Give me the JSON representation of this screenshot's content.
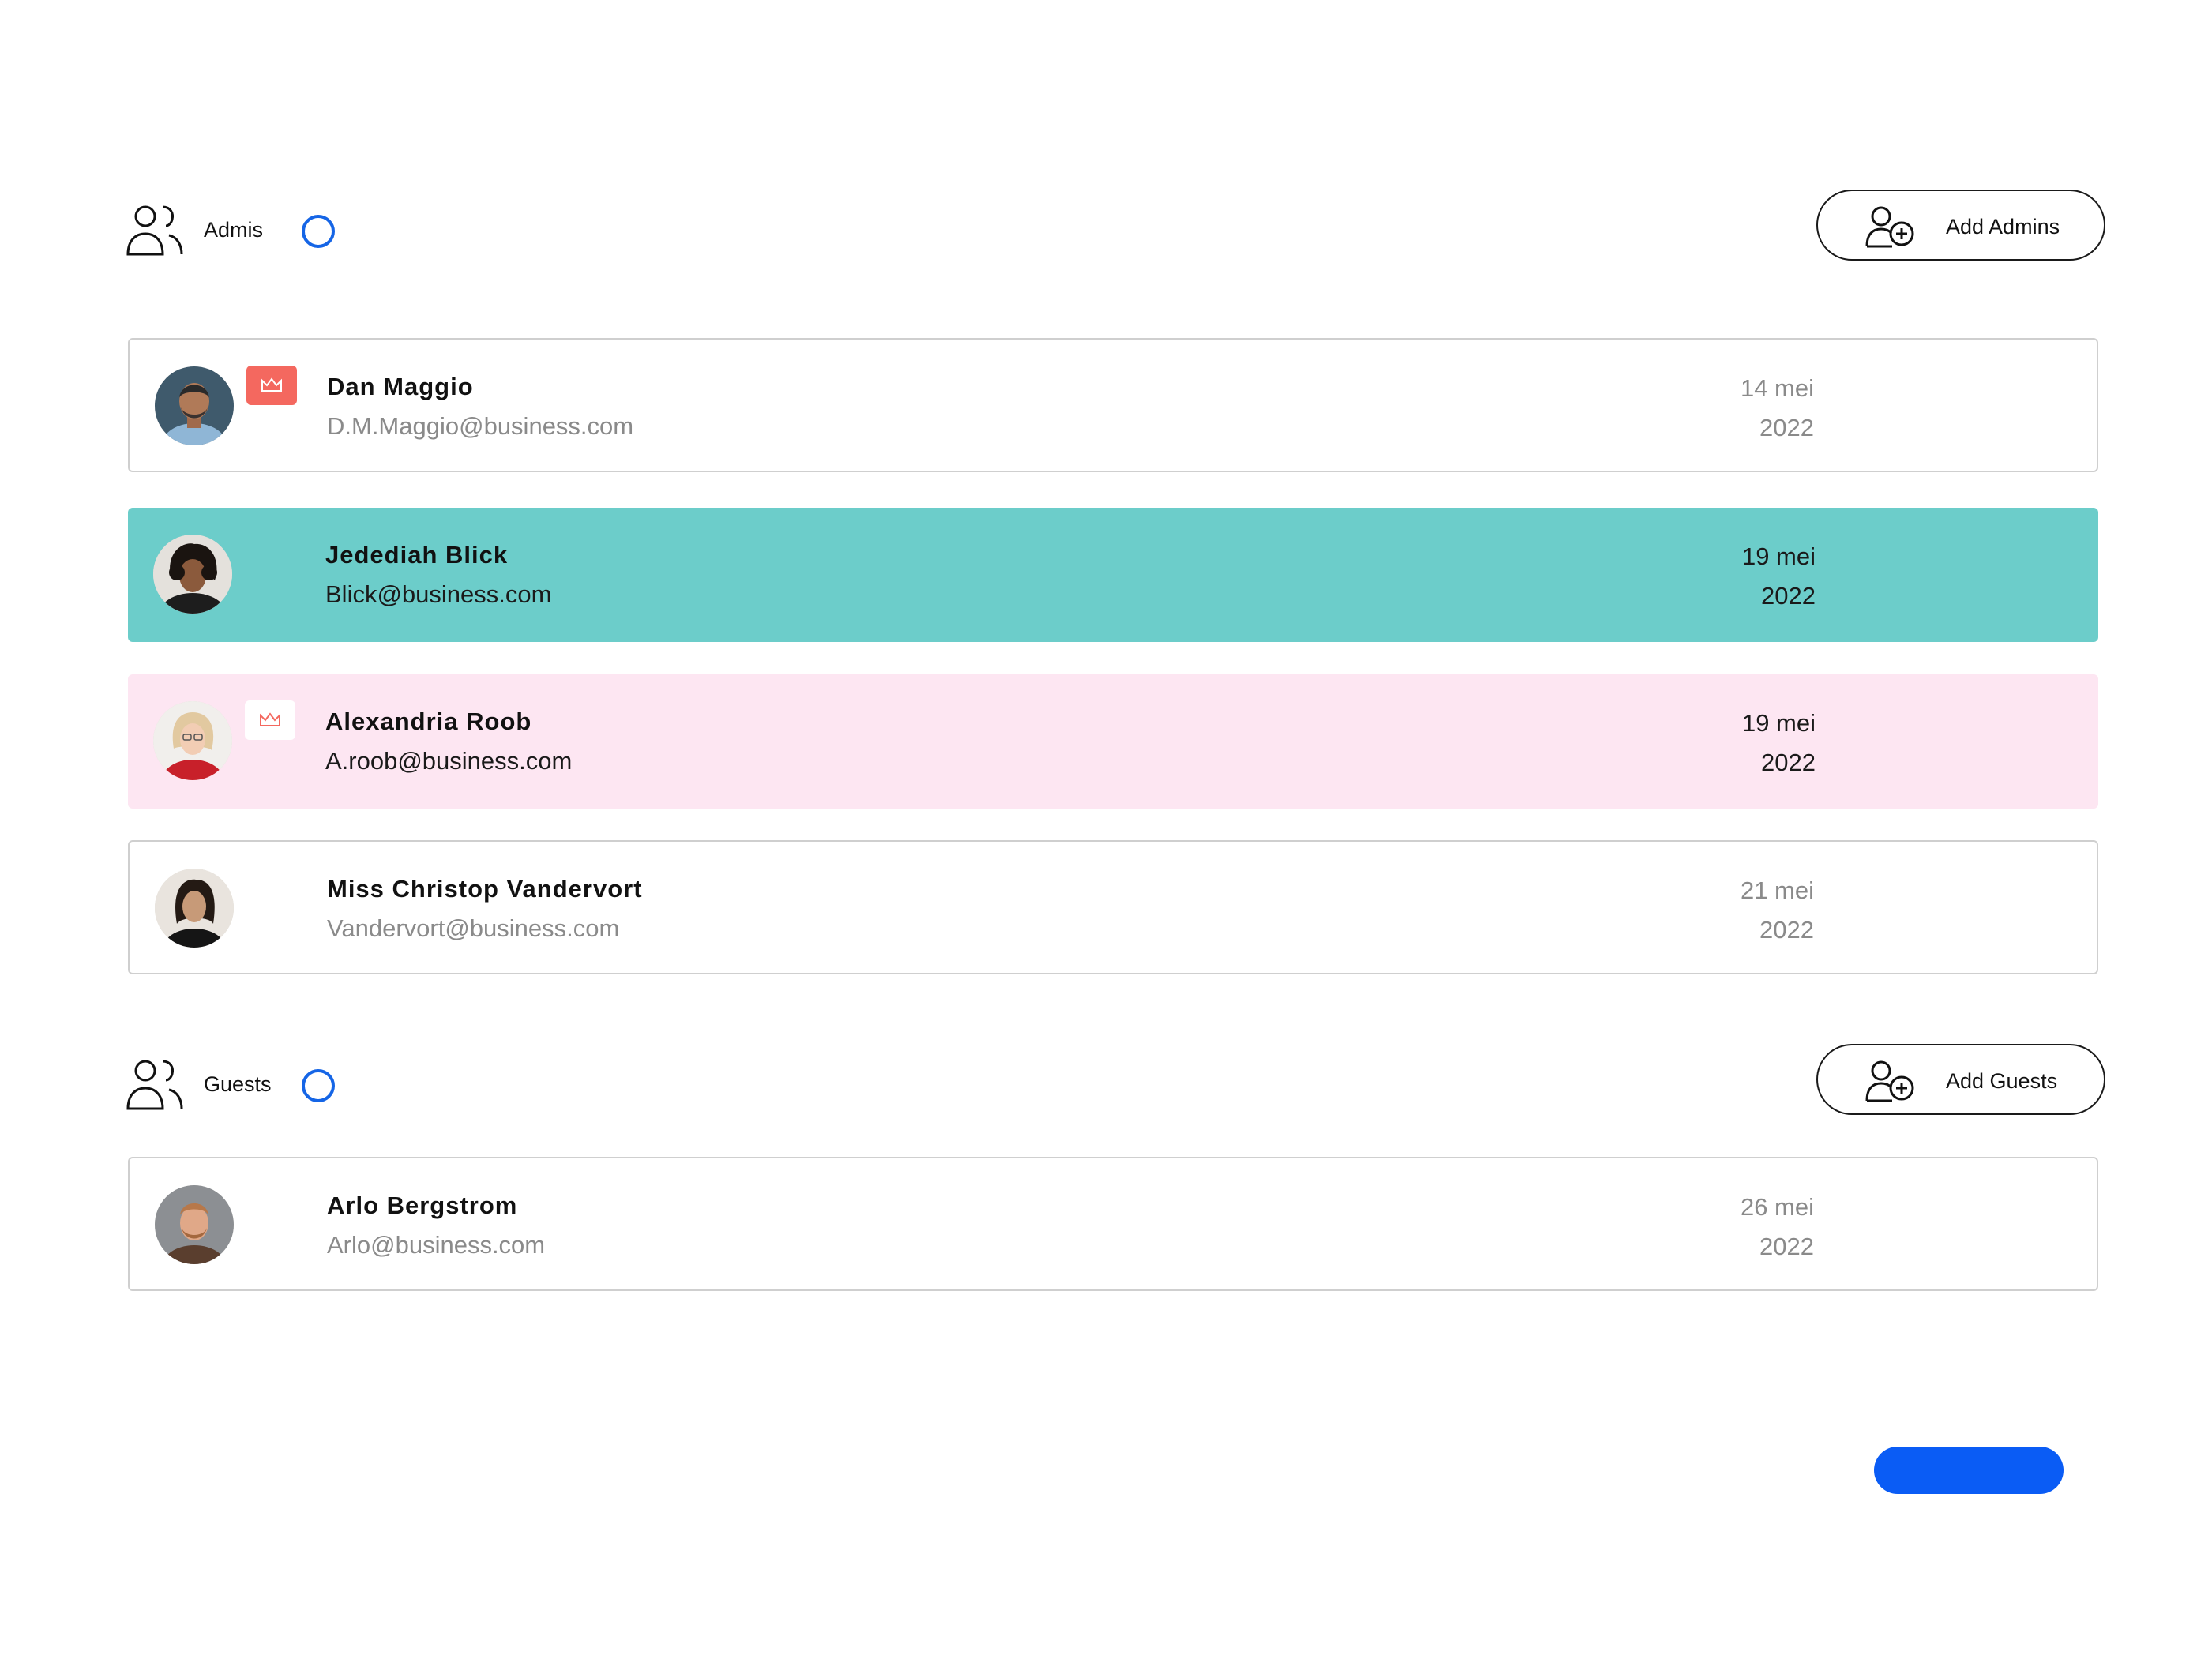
{
  "admins_section": {
    "label": "Admis",
    "icon": "users-icon",
    "add_button_label": "Add Admins",
    "add_button_icon": "user-add-icon",
    "members": [
      {
        "name": "Dan Maggio",
        "email": "D.M.Maggio@business.com",
        "date_day": "14 mei",
        "date_year": "2022",
        "crown": "solid",
        "row_style": "outlined"
      },
      {
        "name": "Jedediah Blick",
        "email": "Blick@business.com",
        "date_day": "19 mei",
        "date_year": "2022",
        "crown": "none",
        "row_style": "teal"
      },
      {
        "name": "Alexandria Roob",
        "email": "A.roob@business.com",
        "date_day": "19 mei",
        "date_year": "2022",
        "crown": "light",
        "row_style": "pink"
      },
      {
        "name": "Miss Christop Vandervort",
        "email": "Vandervort@business.com",
        "date_day": "21 mei",
        "date_year": "2022",
        "crown": "none",
        "row_style": "outlined"
      }
    ]
  },
  "guests_section": {
    "label": "Guests",
    "icon": "users-icon",
    "add_button_label": "Add Guests",
    "add_button_icon": "user-add-icon",
    "members": [
      {
        "name": "Arlo Bergstrom",
        "email": "Arlo@business.com",
        "date_day": "26 mei",
        "date_year": "2022",
        "crown": "none",
        "row_style": "outlined"
      }
    ]
  },
  "colors": {
    "accent_blue": "#0a5cf5",
    "ring_blue": "#1565e6",
    "teal_row": "#6ccdca",
    "pink_row": "#fde6f2",
    "crown_red": "#f4685f"
  }
}
